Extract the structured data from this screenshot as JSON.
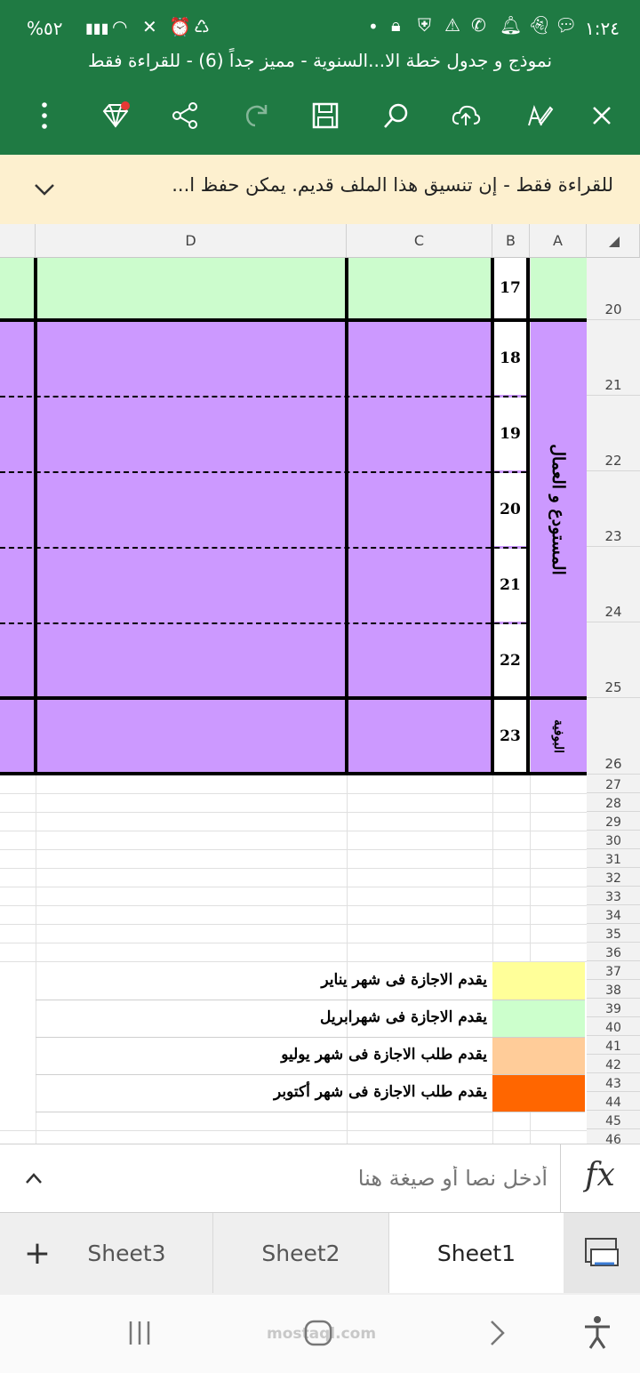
{
  "status_bar": {
    "time": "١:٢٤",
    "battery": "%٥٢"
  },
  "app": {
    "title": "نموذج و جدول خطة الا...السنوية - مميز جداً (6) - للقراءة فقط"
  },
  "toolbar": {
    "icons": [
      "close-icon",
      "pen-icon",
      "cloud-upload-icon",
      "search-icon",
      "save-icon",
      "redo-icon",
      "share-icon",
      "premium-diamond-icon",
      "more-icon"
    ]
  },
  "banner": {
    "text": "للقراءة فقط - إن تنسيق هذا الملف قديم. يمكن حفظ ا..."
  },
  "sheet": {
    "columns": [
      "A",
      "B",
      "C",
      "D"
    ],
    "rows": [
      "20",
      "21",
      "22",
      "23",
      "24",
      "25",
      "26",
      "27",
      "28",
      "29",
      "30",
      "31",
      "32",
      "33",
      "34",
      "35",
      "36",
      "37",
      "38",
      "39",
      "40",
      "41",
      "42",
      "43",
      "44",
      "45",
      "46"
    ],
    "numbers": [
      "17",
      "18",
      "19",
      "20",
      "21",
      "22",
      "23"
    ],
    "group_labels": [
      "المستودع و العمال",
      "البوفية"
    ],
    "colors": {
      "green": "#ccfccd",
      "purple": "#cc99ff",
      "yellow": "#ffff99",
      "light_green": "#ccffcc",
      "peach": "#ffcc99",
      "orange": "#ff6600"
    }
  },
  "legend": [
    {
      "text": "يقدم الاجازة فى شهر يناير",
      "color": "#ffff99"
    },
    {
      "text": "يقدم الاجازة فى شهرابريل",
      "color": "#ccffcc"
    },
    {
      "text": "يقدم طلب الاجازة فى شهر يوليو",
      "color": "#ffcc99"
    },
    {
      "text": "يقدم طلب الاجازة فى شهر أكتوبر",
      "color": "#ff6600"
    }
  ],
  "formula_bar": {
    "placeholder": "أدخل نصا أو صيغة هنا",
    "fx": "fx"
  },
  "sheet_tabs": [
    "Sheet3",
    "Sheet2",
    "Sheet1"
  ],
  "watermark": "mostaql.com"
}
